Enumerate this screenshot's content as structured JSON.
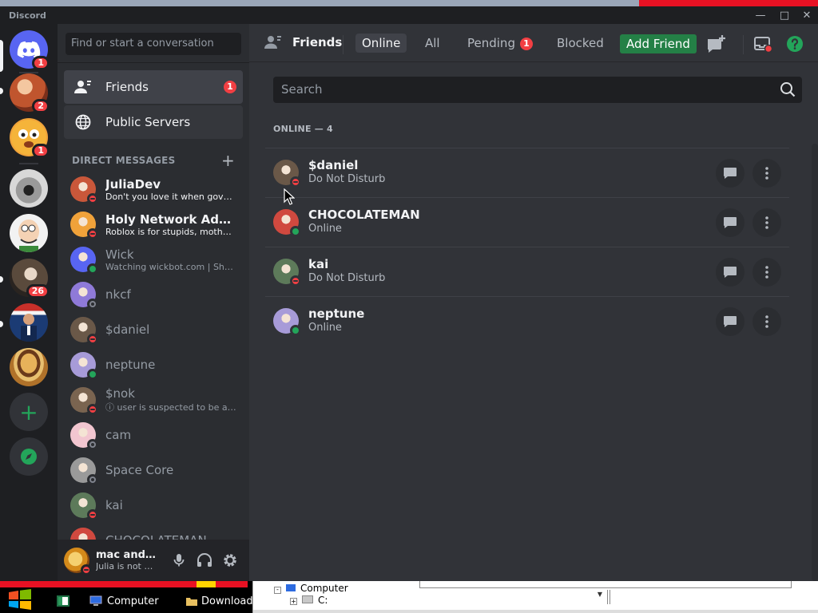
{
  "window": {
    "title": "Discord"
  },
  "rail": {
    "servers": [
      {
        "name": "home",
        "badge": "1",
        "color": "#5865f2"
      },
      {
        "name": "server-2",
        "badge": "2",
        "color": "#c0552e"
      },
      {
        "name": "server-3",
        "badge": "1",
        "color": "#f0a23a"
      },
      {
        "name": "server-4",
        "badge": "",
        "color": "#6b6b6b"
      },
      {
        "name": "server-5",
        "badge": "",
        "color": "#e8e8e8"
      },
      {
        "name": "server-6",
        "badge": "26",
        "color": "#5a4a3c"
      },
      {
        "name": "server-7",
        "badge": "",
        "color": "#1b3b74"
      },
      {
        "name": "server-8",
        "badge": "",
        "color": "#b0722a"
      }
    ]
  },
  "sidebar": {
    "search_placeholder": "Find or start a conversation",
    "nav": [
      {
        "label": "Friends",
        "badge": "1"
      },
      {
        "label": "Public Servers",
        "badge": ""
      }
    ],
    "dm_header": "DIRECT MESSAGES",
    "dms": [
      {
        "name": "JuliaDev",
        "sub": "Don't you love it when govern...",
        "status": "dnd",
        "unread": true,
        "color": "#c9573a"
      },
      {
        "name": "Holy Network Adapter",
        "sub": "Roblox is for stupids, motherf...",
        "status": "dnd",
        "unread": true,
        "color": "#f0a23a"
      },
      {
        "name": "Wick",
        "sub": "Watching wickbot.com | Shar...",
        "status": "online",
        "unread": false,
        "color": "#5865f2"
      },
      {
        "name": "nkcf",
        "sub": "",
        "status": "offline",
        "unread": false,
        "color": "#8f7ad8"
      },
      {
        "name": "$daniel",
        "sub": "",
        "status": "dnd",
        "unread": false,
        "color": "#6a5848"
      },
      {
        "name": "neptune",
        "sub": "",
        "status": "online",
        "unread": false,
        "color": "#a79bd8"
      },
      {
        "name": "$nok",
        "sub": "ⓘ user is suspected to be a p...",
        "status": "dnd",
        "unread": false,
        "color": "#7a6450"
      },
      {
        "name": "cam",
        "sub": "",
        "status": "offline",
        "unread": false,
        "color": "#f2c6d0"
      },
      {
        "name": "Space Core",
        "sub": "",
        "status": "offline",
        "unread": false,
        "color": "#9a9a9a"
      },
      {
        "name": "kai",
        "sub": "",
        "status": "dnd",
        "unread": false,
        "color": "#5d7a5a"
      },
      {
        "name": "CHOCOLATEMAN",
        "sub": "",
        "status": "online",
        "unread": false,
        "color": "#d0493f"
      }
    ]
  },
  "user": {
    "name": "mac and c...",
    "status_text": "Julia is not b...",
    "color": "#e0a030"
  },
  "main": {
    "title": "Friends",
    "tabs": [
      {
        "label": "Online",
        "badge": ""
      },
      {
        "label": "All",
        "badge": ""
      },
      {
        "label": "Pending",
        "badge": "1"
      },
      {
        "label": "Blocked",
        "badge": ""
      }
    ],
    "add_friend": "Add Friend",
    "search_placeholder": "Search",
    "online_header": "ONLINE — 4",
    "friends": [
      {
        "name": "$daniel",
        "status_text": "Do Not Disturb",
        "status": "dnd",
        "color": "#6a5848"
      },
      {
        "name": "CHOCOLATEMAN",
        "status_text": "Online",
        "status": "online",
        "color": "#d0493f"
      },
      {
        "name": "kai",
        "status_text": "Do Not Disturb",
        "status": "dnd",
        "color": "#5d7a5a"
      },
      {
        "name": "neptune",
        "status_text": "Online",
        "status": "online",
        "color": "#a79bd8"
      }
    ]
  },
  "taskbar": {
    "items": [
      {
        "label": "Computer"
      },
      {
        "label": "Downloads"
      }
    ]
  },
  "explorer": {
    "root": "Computer",
    "drive": "C:"
  }
}
